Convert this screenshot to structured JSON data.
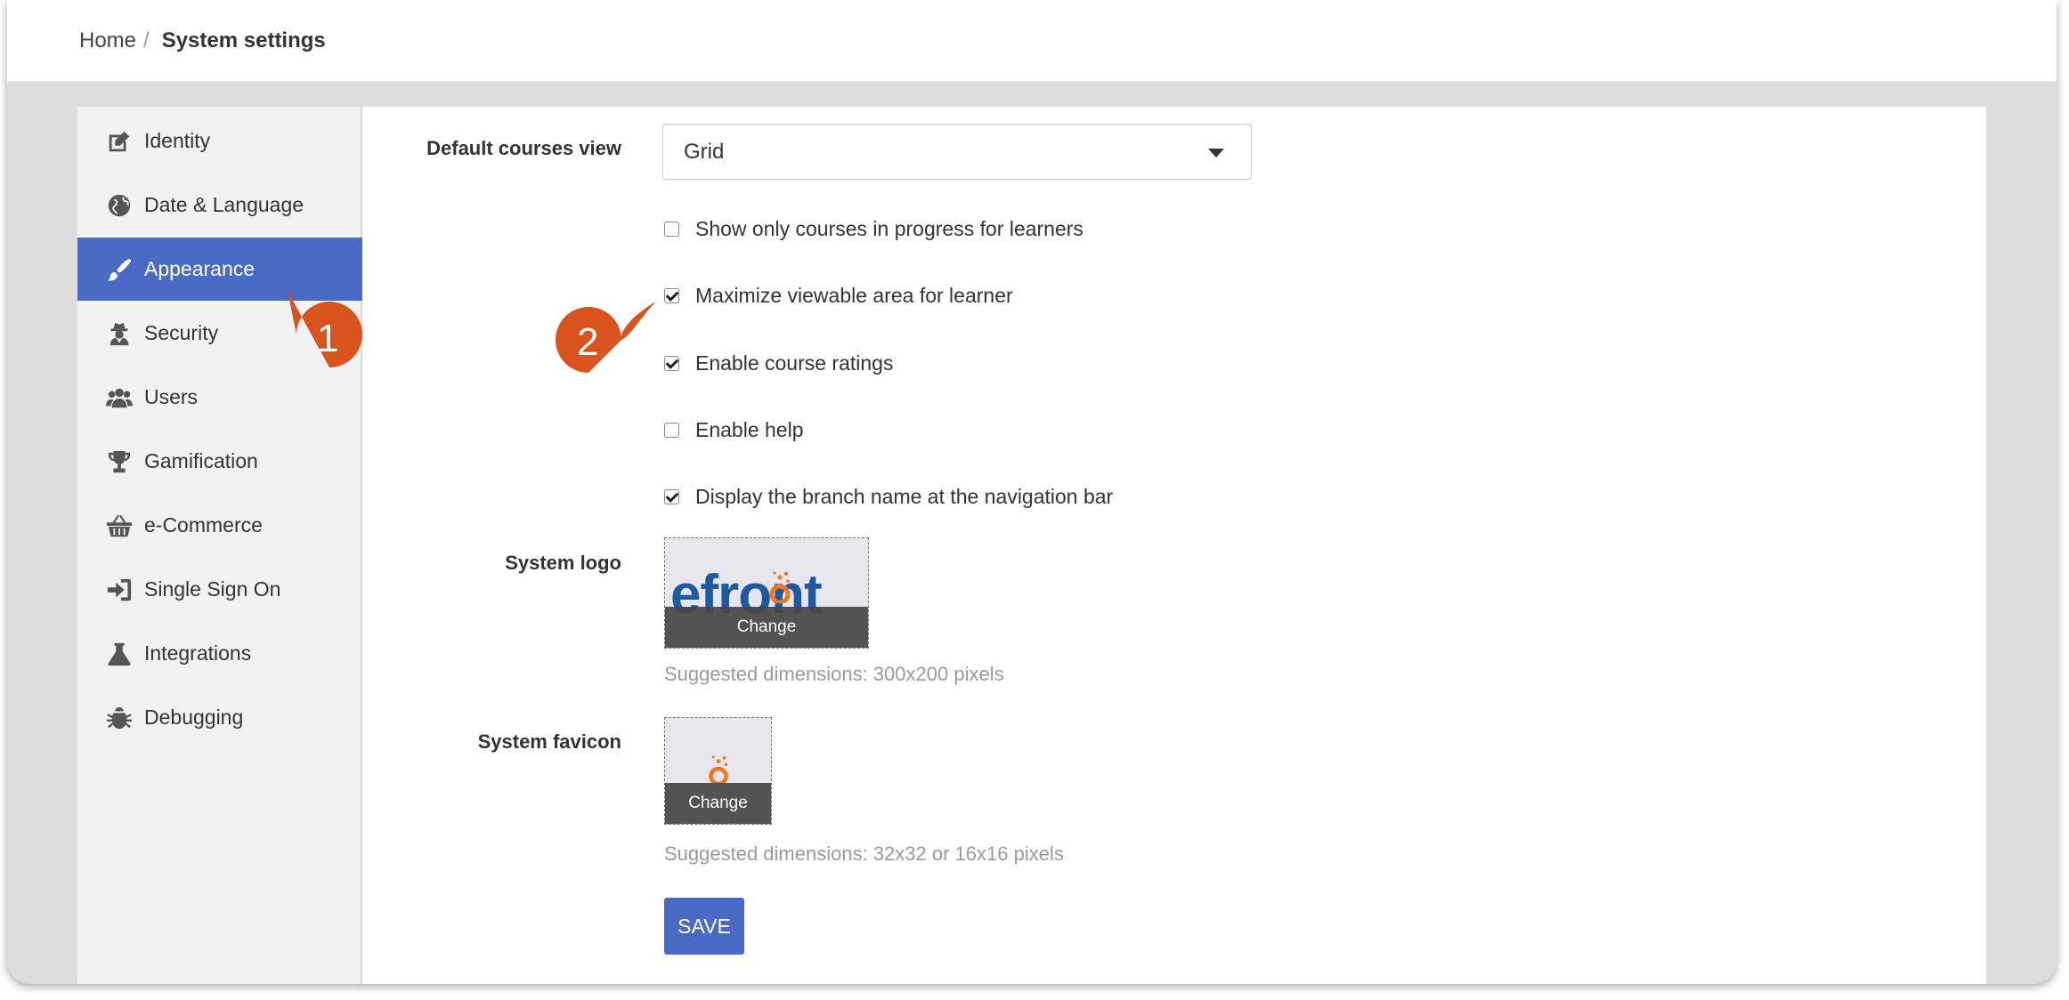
{
  "breadcrumb": {
    "home": "Home",
    "separator": "/",
    "current": "System settings"
  },
  "sidebar": {
    "items": [
      {
        "label": "Identity",
        "icon": "edit-icon",
        "active": false
      },
      {
        "label": "Date & Language",
        "icon": "globe-icon",
        "active": false
      },
      {
        "label": "Appearance",
        "icon": "paintbrush-icon",
        "active": true
      },
      {
        "label": "Security",
        "icon": "user-secret-icon",
        "active": false
      },
      {
        "label": "Users",
        "icon": "users-icon",
        "active": false
      },
      {
        "label": "Gamification",
        "icon": "trophy-icon",
        "active": false
      },
      {
        "label": "e-Commerce",
        "icon": "basket-icon",
        "active": false
      },
      {
        "label": "Single Sign On",
        "icon": "sign-in-icon",
        "active": false
      },
      {
        "label": "Integrations",
        "icon": "flask-icon",
        "active": false
      },
      {
        "label": "Debugging",
        "icon": "bug-icon",
        "active": false
      }
    ]
  },
  "form": {
    "default_view_label": "Default courses view",
    "default_view_value": "Grid",
    "checkboxes": [
      {
        "label": "Show only courses in progress for learners",
        "checked": false
      },
      {
        "label": "Maximize viewable area for learner",
        "checked": true
      },
      {
        "label": "Enable course ratings",
        "checked": true
      },
      {
        "label": "Enable help",
        "checked": false
      },
      {
        "label": "Display the branch name at the navigation bar",
        "checked": true
      }
    ],
    "logo_label": "System logo",
    "logo_text": "efront",
    "logo_change": "Change",
    "logo_hint": "Suggested dimensions: 300x200 pixels",
    "favicon_label": "System favicon",
    "favicon_change": "Change",
    "favicon_hint": "Suggested dimensions: 32x32 or 16x16 pixels",
    "save_label": "SAVE"
  },
  "annotations": {
    "step1": "1",
    "step2": "2"
  },
  "colors": {
    "accent": "#4a6ac6",
    "callout": "#d9531e",
    "logo_blue": "#1f5aa0",
    "logo_orange": "#f07a1a"
  }
}
